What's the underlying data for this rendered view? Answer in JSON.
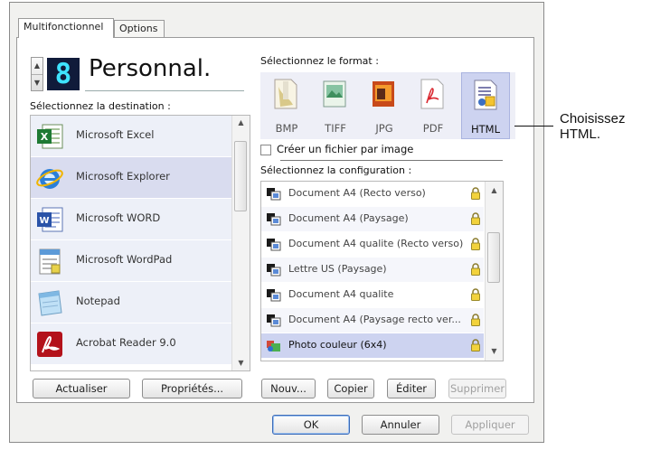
{
  "tabs": [
    "Multifonctionnel",
    "Options"
  ],
  "preset": {
    "number": "8",
    "name": "Personnal."
  },
  "destination": {
    "label": "Sélectionnez la destination :",
    "items": [
      "Microsoft Excel",
      "Microsoft Explorer",
      "Microsoft WORD",
      "Microsoft WordPad",
      "Notepad",
      "Acrobat Reader 9.0"
    ],
    "selected": "Microsoft Explorer",
    "icons": [
      "excel-icon",
      "internet-explorer-icon",
      "word-icon",
      "wordpad-icon",
      "notepad-icon",
      "acrobat-icon"
    ]
  },
  "format": {
    "label": "Sélectionnez le format :",
    "items": [
      "BMP",
      "TIFF",
      "JPG",
      "PDF",
      "HTML"
    ],
    "selected": "HTML"
  },
  "checkbox_label": "Créer un fichier par image",
  "configuration": {
    "label": "Sélectionnez la configuration :",
    "items": [
      "Document A4 (Recto verso)",
      "Document A4 (Paysage)",
      "Document A4 qualite (Recto verso)",
      "Lettre US (Paysage)",
      "Document A4 qualite",
      "Document A4 (Paysage recto ver...",
      "Photo couleur (6x4)"
    ],
    "selected": "Photo couleur (6x4)"
  },
  "buttons": {
    "refresh": "Actualiser",
    "properties": "Propriétés...",
    "new": "Nouv...",
    "copy": "Copier",
    "edit": "Éditer",
    "delete": "Supprimer",
    "ok": "OK",
    "cancel": "Annuler",
    "apply": "Appliquer"
  },
  "callout": {
    "line1": "Choisissez",
    "line2": "HTML."
  },
  "colors": {
    "selection": "#cdd3f0",
    "list_bg": "#edf0f8",
    "digit_bg": "#101b3a",
    "digit_fg": "#3ee3ff"
  }
}
